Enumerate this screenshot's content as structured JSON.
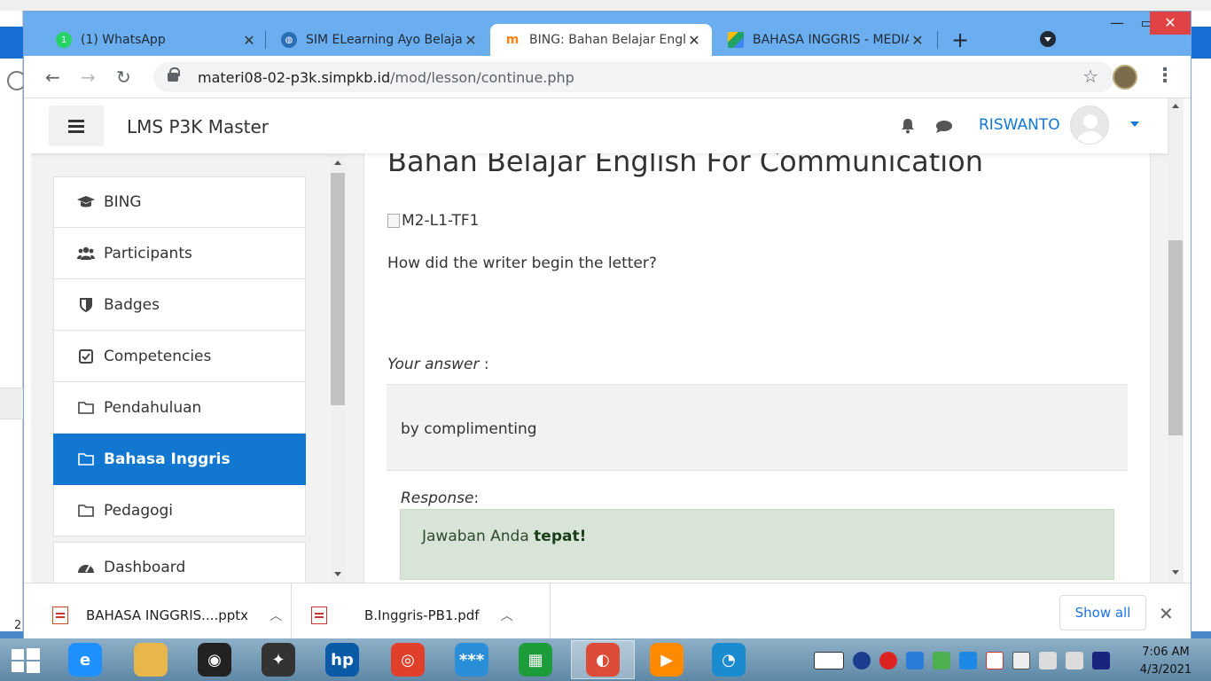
{
  "browser": {
    "tabs": [
      {
        "title": "(1) WhatsApp",
        "active": false,
        "icon": "whatsapp-icon",
        "color": "#25d366"
      },
      {
        "title": "SIM ELearning Ayo Belajar",
        "active": false,
        "icon": "elearning-icon",
        "color": "#2a6fb5"
      },
      {
        "title": "BING: Bahan Belajar Englis",
        "active": true,
        "icon": "moodle-icon",
        "color": "#f98012"
      },
      {
        "title": "BAHASA INGGRIS - MEDIA",
        "active": false,
        "icon": "google-drive-icon",
        "color": "#1fa463"
      }
    ],
    "url": {
      "host": "materi08-02-p3k.simpkb.id",
      "path": "/mod/lesson/continue.php"
    }
  },
  "site": {
    "name": "LMS P3K Master",
    "user": "RISWANTO"
  },
  "drawer": {
    "items": [
      {
        "label": "BING",
        "icon": "graduation-cap-icon",
        "active": false
      },
      {
        "label": "Participants",
        "icon": "users-icon",
        "active": false
      },
      {
        "label": "Badges",
        "icon": "shield-icon",
        "active": false
      },
      {
        "label": "Competencies",
        "icon": "checkbox-icon",
        "active": false
      },
      {
        "label": "Pendahuluan",
        "icon": "folder-icon",
        "active": false
      },
      {
        "label": "Bahasa Inggris",
        "icon": "folder-icon",
        "active": true
      },
      {
        "label": "Pedagogi",
        "icon": "folder-icon",
        "active": false
      }
    ],
    "dashboard": {
      "label": "Dashboard",
      "icon": "dashboard-icon"
    }
  },
  "lesson": {
    "title": "Bahan Belajar English For Communication",
    "image_alt": "M2-L1-TF1",
    "question": "How did the writer begin the letter?",
    "answer_label": "Your answer",
    "answer_suffix": " :",
    "answer": "by complimenting",
    "response_label": "Response",
    "response_suffix": ":",
    "response_prefix": "Jawaban Anda ",
    "response_strong": "tepat!"
  },
  "downloads": {
    "items": [
      {
        "name": "BAHASA INGGRIS....pptx",
        "icon": "pptx-file-icon"
      },
      {
        "name": "B.Inggris-PB1.pdf",
        "icon": "pdf-file-icon"
      }
    ],
    "show_all": "Show all"
  },
  "taskbar": {
    "time": "7:06 AM",
    "date": "4/3/2021",
    "apps": [
      {
        "name": "internet-explorer-icon",
        "color": "#1e90ff",
        "glyph": "e"
      },
      {
        "name": "file-explorer-icon",
        "color": "#e8b64a",
        "glyph": ""
      },
      {
        "name": "webcam-icon",
        "color": "#222222",
        "glyph": "◉"
      },
      {
        "name": "puzzle-app-icon",
        "color": "#333333",
        "glyph": "✦"
      },
      {
        "name": "hp-icon",
        "color": "#0a5aa8",
        "glyph": "hp"
      },
      {
        "name": "camera-app-icon",
        "color": "#e0402a",
        "glyph": "◎"
      },
      {
        "name": "password-app-icon",
        "color": "#2a8fd8",
        "glyph": "***"
      },
      {
        "name": "store-icon",
        "color": "#1c9c3a",
        "glyph": "▦"
      },
      {
        "name": "chrome-icon",
        "color": "#dd4b39",
        "glyph": "◐"
      },
      {
        "name": "media-player-icon",
        "color": "#ff8a00",
        "glyph": "▶"
      },
      {
        "name": "edge-icon",
        "color": "#1b8bd0",
        "glyph": "◔"
      }
    ]
  },
  "colors": {
    "accent": "#1177d1",
    "response_bg": "#d7e4d7"
  }
}
